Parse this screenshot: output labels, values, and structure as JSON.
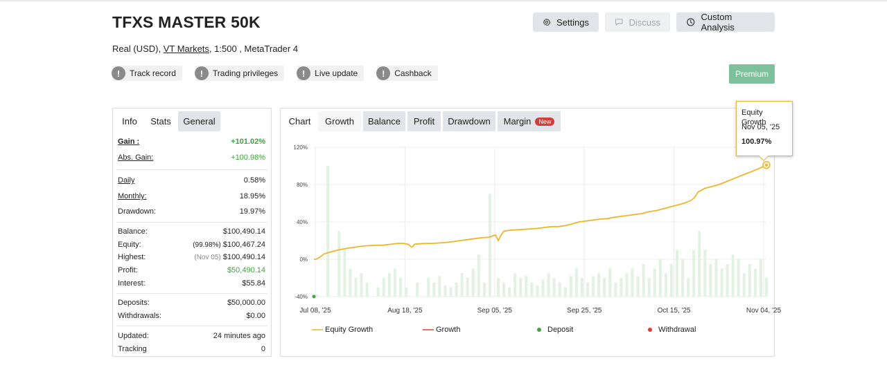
{
  "header": {
    "title": "TFXS MASTER 50K",
    "settings_label": "Settings",
    "discuss_label": "Discuss",
    "custom_analysis_label": "Custom Analysis"
  },
  "account": {
    "type": "Real (USD),",
    "broker": "VT Markets",
    "leverage": ", 1:500 , MetaTrader 4"
  },
  "badges": [
    {
      "label": "Track record",
      "icon": "exclamation-icon"
    },
    {
      "label": "Trading privileges",
      "icon": "exclamation-icon"
    },
    {
      "label": "Live update",
      "icon": "exclamation-icon"
    },
    {
      "label": "Cashback",
      "icon": "exclamation-icon"
    }
  ],
  "premium_label": "Premium",
  "stats_tabs": [
    "Info",
    "Stats",
    "General"
  ],
  "stats": {
    "gain": {
      "label": "Gain :",
      "value": "+101.02%"
    },
    "abs_gain": {
      "label": "Abs. Gain:",
      "value": "+100.98%"
    },
    "daily": {
      "label": "Daily",
      "value": "0.58%"
    },
    "monthly": {
      "label": "Monthly:",
      "value": "18.95%"
    },
    "drawdown": {
      "label": "Drawdown:",
      "value": "19.97%"
    },
    "balance": {
      "label": "Balance:",
      "value": "$100,490.14"
    },
    "equity": {
      "label": "Equity:",
      "pct": "(99.98%)",
      "value": "$100,467.24"
    },
    "highest": {
      "label": "Highest:",
      "date": "(Nov 05)",
      "value": "$100,490.14"
    },
    "profit": {
      "label": "Profit:",
      "value": "$50,490.14"
    },
    "interest": {
      "label": "Interest:",
      "value": "$55.84"
    },
    "deposits": {
      "label": "Deposits:",
      "value": "$50,000.00"
    },
    "withdrawals": {
      "label": "Withdrawals:",
      "value": "$0.00"
    },
    "updated": {
      "label": "Updated:",
      "value": "24 minutes ago"
    },
    "tracking": {
      "label": "Tracking",
      "value": "0"
    }
  },
  "chart_tabs": {
    "chart": "Chart",
    "growth": "Growth",
    "balance": "Balance",
    "profit": "Profit",
    "drawdown": "Drawdown",
    "margin": "Margin",
    "new_badge": "New"
  },
  "tooltip": {
    "series": "Equity Growth",
    "date": "Nov 05, '25",
    "value": "100.97%"
  },
  "legend": {
    "equity_growth": "Equity Growth",
    "growth": "Growth",
    "deposit": "Deposit",
    "withdrawal": "Withdrawal"
  },
  "colors": {
    "equity_line": "#f0b429",
    "growth_line": "#e53935",
    "deposit": "#43a047",
    "withdrawal": "#e53935",
    "bars": "#e3f1e3",
    "premium": "#7cc19b",
    "positive": "#3aa63a"
  },
  "chart_data": {
    "type": "line",
    "title": "",
    "xlabel": "",
    "ylabel": "",
    "y_ticks": [
      "120%",
      "80%",
      "40%",
      "0%",
      "-40%"
    ],
    "y_tick_values": [
      120,
      80,
      40,
      0,
      -40
    ],
    "x_ticks": [
      "Jul 08, '25",
      "Aug 18, '25",
      "Sep 05, '25",
      "Sep 25, '25",
      "Oct 15, '25",
      "Nov 04, '25"
    ],
    "ylim": [
      -40,
      120
    ],
    "grid": true,
    "legend_position": "bottom",
    "series": [
      {
        "name": "Equity Growth",
        "x": [
          0,
          3,
          8,
          15,
          25,
          35,
          50,
          60,
          68,
          78,
          88,
          98,
          110,
          120,
          128,
          135,
          140,
          142,
          144,
          150,
          160,
          170,
          180,
          190,
          200,
          210,
          220,
          230,
          240,
          250,
          260,
          264,
          268,
          272,
          280,
          300,
          320,
          340,
          350,
          360,
          370,
          380,
          390,
          400,
          410,
          420,
          430,
          440,
          450,
          460,
          470,
          480,
          490,
          500,
          510,
          520,
          530,
          540,
          545,
          550,
          560,
          570,
          580,
          590,
          600,
          610,
          620,
          630,
          640,
          648
        ],
        "y": [
          0,
          0,
          2,
          6,
          8,
          10,
          12,
          13,
          14,
          14.5,
          15,
          15,
          16,
          17,
          17,
          16,
          13,
          14,
          16,
          16.5,
          17,
          17,
          17.5,
          18,
          19,
          20,
          21,
          22,
          23,
          23.5,
          26,
          20,
          26,
          30,
          31,
          32,
          33,
          35,
          35,
          36,
          38,
          40,
          41,
          42,
          43,
          43.5,
          45,
          46,
          47,
          48,
          49,
          51,
          52,
          54,
          56,
          58,
          60,
          63,
          66,
          72,
          76,
          78,
          80,
          83,
          86,
          89,
          92,
          95,
          98,
          100.97
        ]
      }
    ],
    "deposits": [
      {
        "x": 0,
        "y": -40
      }
    ],
    "withdrawals": [],
    "bars": {
      "x": [
        4,
        20,
        36,
        44,
        52,
        60,
        68,
        76,
        92,
        100,
        108,
        116,
        124,
        132,
        148,
        164,
        172,
        180,
        188,
        196,
        204,
        212,
        220,
        228,
        236,
        244,
        252,
        264,
        272,
        280,
        288,
        296,
        304,
        312,
        320,
        328,
        336,
        344,
        352,
        360,
        368,
        376,
        384,
        392,
        400,
        408,
        416,
        424,
        432,
        440,
        448,
        456,
        464,
        472,
        480,
        488,
        496,
        504,
        512,
        520,
        528,
        536,
        544,
        552,
        560,
        568,
        576,
        584,
        592,
        600,
        608,
        616,
        624,
        632,
        640,
        648
      ],
      "y": [
        -38,
        100,
        30,
        10,
        -10,
        -20,
        -15,
        -25,
        -30,
        -20,
        -15,
        -10,
        -20,
        -30,
        -25,
        -20,
        -25,
        -18,
        -28,
        -30,
        -25,
        -15,
        -20,
        -10,
        5,
        -25,
        70,
        -20,
        -25,
        -30,
        -15,
        -20,
        -18,
        -25,
        -28,
        -22,
        -15,
        -20,
        -25,
        -30,
        -18,
        -10,
        -20,
        -25,
        -18,
        -15,
        -20,
        -10,
        -25,
        -20,
        -15,
        -10,
        -18,
        -5,
        -20,
        -10,
        0,
        -15,
        -5,
        10,
        0,
        -20,
        10,
        30,
        10,
        -5,
        0,
        -10,
        -5,
        5,
        0,
        -15,
        -5,
        -10,
        0,
        -20
      ]
    }
  }
}
